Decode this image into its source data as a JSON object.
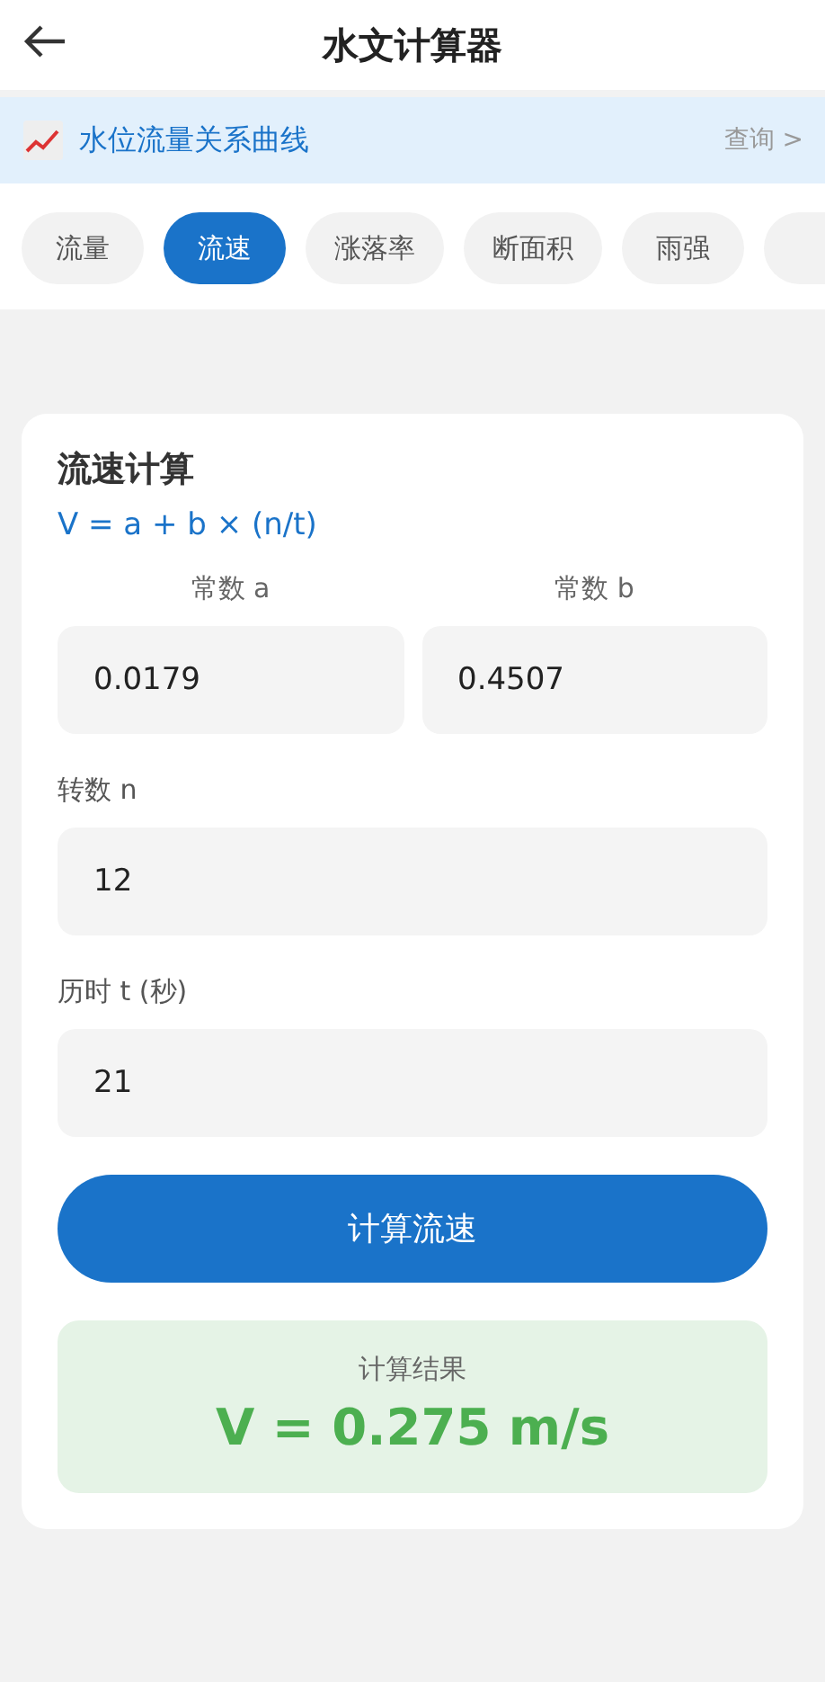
{
  "header": {
    "title": "水文计算器"
  },
  "banner": {
    "label": "水位流量关系曲线",
    "action": "查询 >"
  },
  "tabs": [
    {
      "label": "流量",
      "selected": false
    },
    {
      "label": "流速",
      "selected": true
    },
    {
      "label": "涨落率",
      "selected": false
    },
    {
      "label": "断面积",
      "selected": false
    },
    {
      "label": "雨强",
      "selected": false
    },
    {
      "selected": false
    }
  ],
  "card": {
    "title": "流速计算",
    "formula": "V = a + b × (n/t)",
    "constants": [
      {
        "label": "常数 a",
        "value": "0.0179"
      },
      {
        "label": "常数 b",
        "value": "0.4507"
      }
    ],
    "fields": [
      {
        "label": "转数 n",
        "value": "12"
      },
      {
        "label": "历时 t (秒)",
        "value": "21"
      }
    ],
    "button": "计算流速",
    "result": {
      "label": "计算结果",
      "value": "V = 0.275 m/s"
    }
  }
}
